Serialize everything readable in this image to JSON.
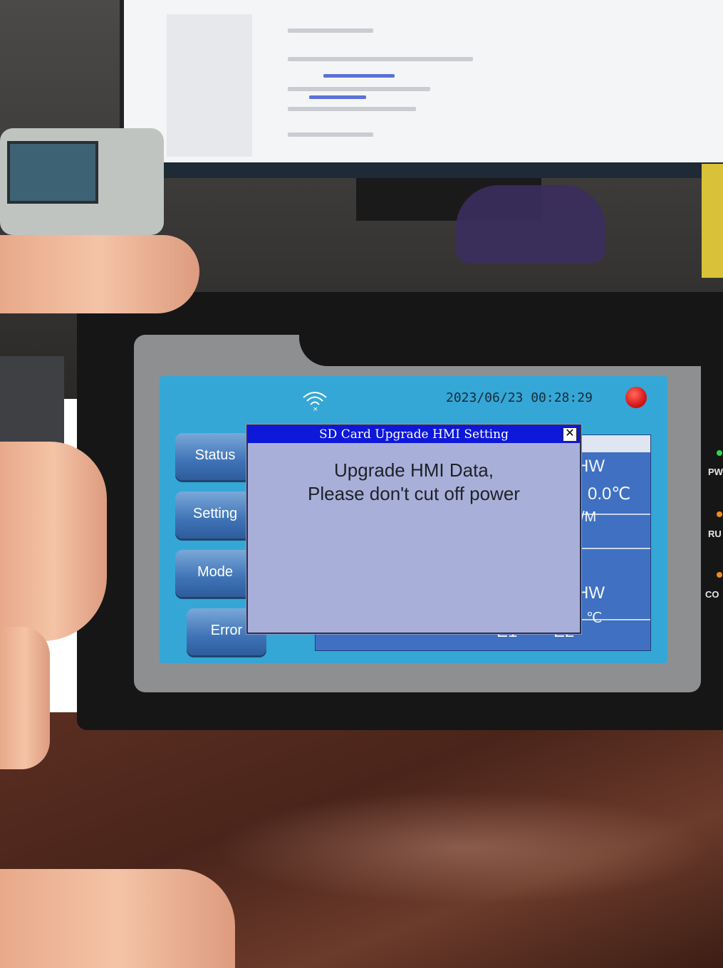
{
  "hmi": {
    "datetime": "2023/06/23 00:28:29",
    "wifi_icon": "wifi-signal-icon",
    "alarm_icon": "alarm-indicator-icon",
    "alarm_color": "#d8171a",
    "nav_buttons": [
      {
        "label": "Status"
      },
      {
        "label": "Setting"
      },
      {
        "label": "Mode"
      },
      {
        "label": "Error"
      }
    ],
    "panel": {
      "row1_unit": "HW",
      "row1_temp": "0.0℃",
      "row1_label": "/M",
      "row2_unit": "HW",
      "row2_temp": "℃",
      "error_labels": [
        "E1",
        "E2"
      ]
    },
    "dialog": {
      "title": "SD Card Upgrade HMI Setting",
      "close_label": "✕",
      "message_line1": "Upgrade HMI Data,",
      "message_line2": "Please don't cut off power"
    }
  },
  "device": {
    "indicator_labels": [
      "PW",
      "RU",
      "CO"
    ],
    "indicator_colors": [
      "#2fd64a",
      "#f08a24",
      "#f08a24"
    ]
  }
}
